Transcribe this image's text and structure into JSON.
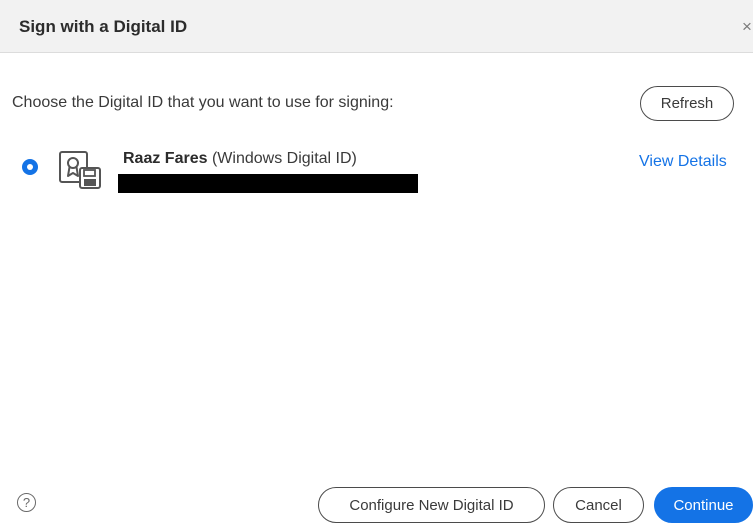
{
  "dialog": {
    "title": "Sign with a Digital ID",
    "close_glyph": "×"
  },
  "prompt": "Choose the Digital ID that you want to use for signing:",
  "refresh_label": "Refresh",
  "digital_id": {
    "selected": true,
    "icon": "certificate-icon",
    "name": "Raaz Fares",
    "type": "(Windows Digital ID)",
    "view_details_label": "View Details"
  },
  "footer": {
    "help_glyph": "?",
    "configure_label": "Configure New Digital ID",
    "cancel_label": "Cancel",
    "continue_label": "Continue"
  },
  "colors": {
    "accent": "#1473e6",
    "header_bg": "#f2f2f2"
  }
}
